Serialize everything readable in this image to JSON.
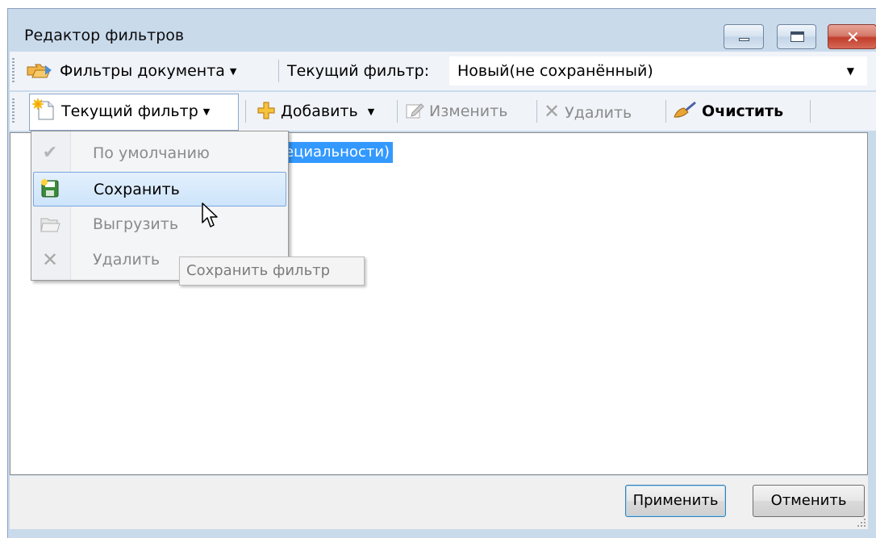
{
  "window": {
    "title": "Редактор фильтров",
    "buttons": [
      "minimize",
      "maximize",
      "close"
    ]
  },
  "toolbar1": {
    "doc_filters_label": "Фильтры документа",
    "current_filter_caption": "Текущий фильтр:",
    "current_filter_value": "Новый(не сохранённый)"
  },
  "toolbar2": {
    "current_filter_menu_label": "Текущий фильтр",
    "add_label": "Добавить",
    "edit_label": "Изменить",
    "delete_label": "Удалить",
    "clear_label": "Очистить"
  },
  "menu": {
    "items": [
      {
        "label": "По умолчанию",
        "icon": "check-icon",
        "enabled": false
      },
      {
        "label": "Сохранить",
        "icon": "save-icon",
        "enabled": true,
        "hovered": true
      },
      {
        "label": "Выгрузить",
        "icon": "folder-open-icon",
        "enabled": false
      },
      {
        "label": "Удалить",
        "icon": "delete-x-icon",
        "enabled": false
      }
    ]
  },
  "tooltip": "Сохранить фильтр",
  "tree": {
    "selected_node_visible_text": "ециальности)"
  },
  "footer": {
    "apply_label": "Применить",
    "cancel_label": "Отменить"
  },
  "colors": {
    "selection": "#3399ff",
    "menu_hover": "#cde4fb",
    "window_frame": "#c9daeb"
  }
}
